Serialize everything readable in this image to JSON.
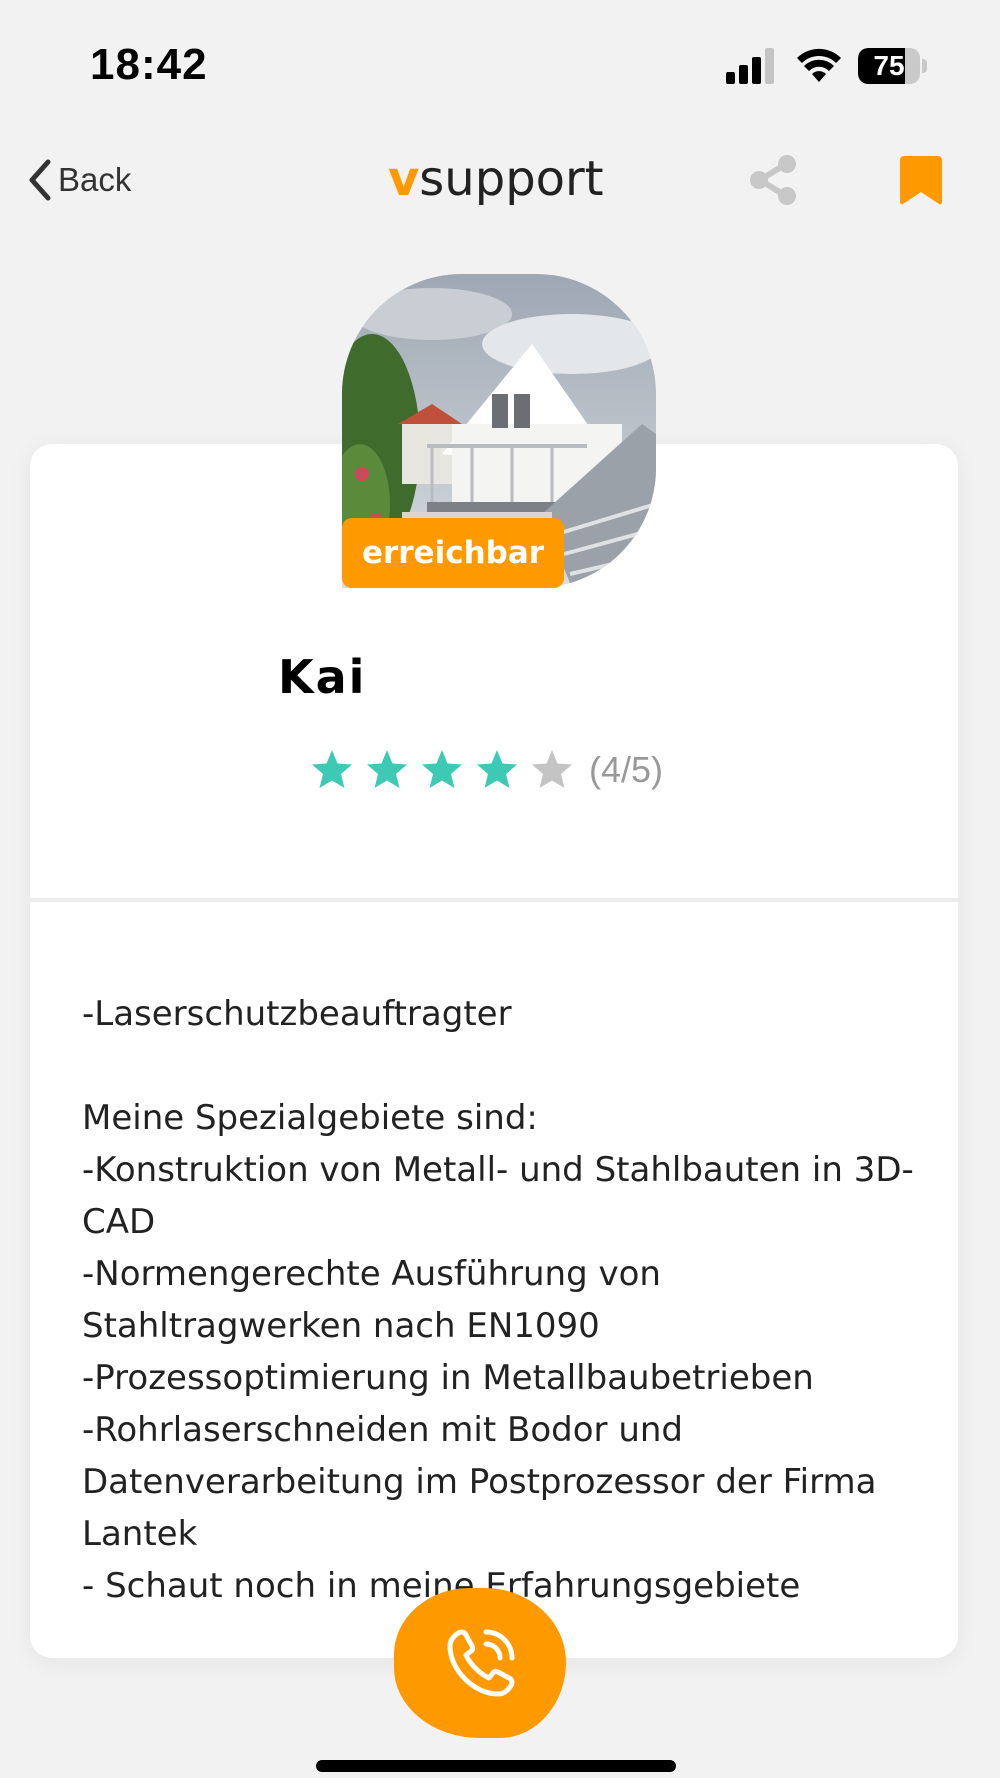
{
  "status_bar": {
    "time": "18:42",
    "battery_level": "75",
    "battery_fraction": 0.75,
    "icons": [
      "signal-icon",
      "wifi-icon",
      "battery-icon"
    ]
  },
  "nav": {
    "back_label": "Back",
    "brand_prefix": "v",
    "brand_suffix": "support",
    "icons": [
      "chevron-left-icon",
      "share-icon",
      "bookmark-icon"
    ]
  },
  "colors": {
    "accent": "#ff9900",
    "star_filled": "#3dc9b3",
    "star_empty": "#c4c4c4",
    "background": "#f2f2f2"
  },
  "profile": {
    "status": "erreichbar",
    "name": "Kai",
    "rating_value": 4,
    "rating_max": 5,
    "rating_text": "(4/5)"
  },
  "description": "-Laserschutzbeauftragter\n\nMeine Spezialgebiete sind:\n-Konstruktion von Metall- und Stahlbauten in 3D-CAD\n-Normengerechte Ausführung von Stahltragwerken nach EN1090\n-Prozessoptimierung in Metallbaubetrieben\n-Rohrlaserschneiden mit Bodor und Datenverarbeitung im Postprozessor der Firma Lantek\n- Schaut noch in meine Erfahrungsgebiete",
  "call_button": {
    "icon": "phone-call-icon"
  }
}
